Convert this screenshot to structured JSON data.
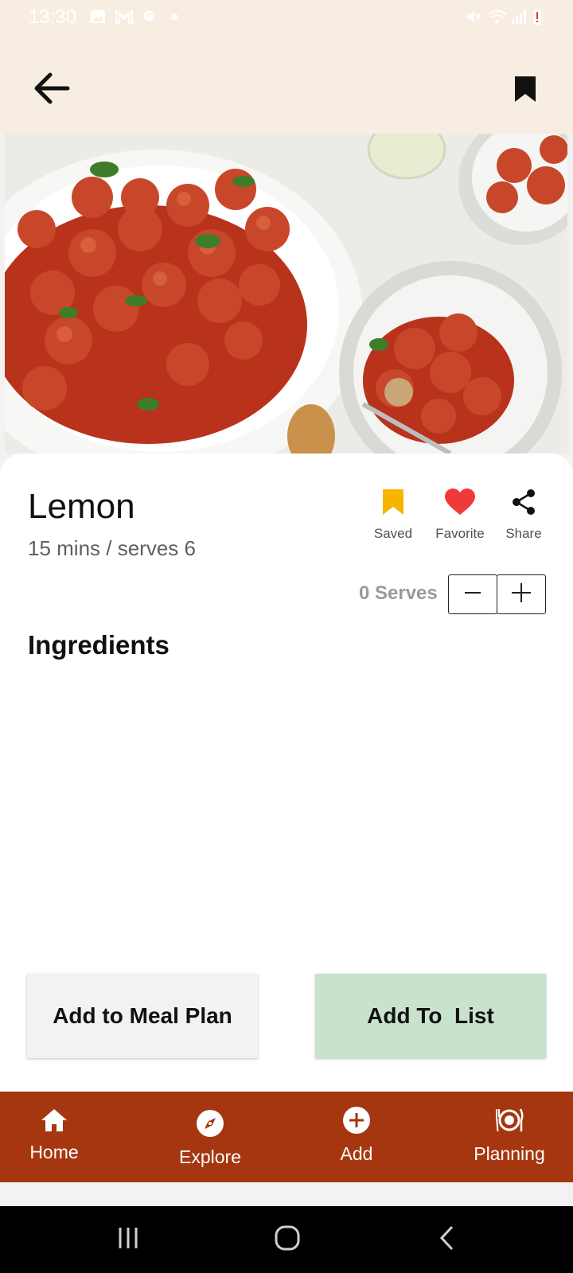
{
  "status_bar": {
    "time": "13:30",
    "left_icons": [
      "image-icon",
      "gmail-icon",
      "google-icon",
      "dot-icon"
    ],
    "right_icons": [
      "mute-icon",
      "wifi-icon",
      "signal-icon",
      "battery-alert-icon"
    ]
  },
  "app_bar": {
    "back_icon": "arrow-back-icon",
    "bookmark_icon": "bookmark-icon"
  },
  "recipe": {
    "title": "Lemon",
    "meta": "15 mins / serves 6",
    "image_subject": "meatballs in tomato sauce"
  },
  "actions": {
    "saved_label": "Saved",
    "favorite_label": "Favorite",
    "share_label": "Share",
    "saved_color": "#f7b500",
    "favorite_color": "#f03a3a"
  },
  "serves": {
    "label": "0 Serves"
  },
  "ingredients": {
    "heading": "Ingredients",
    "items": []
  },
  "buttons": {
    "meal_plan_label": "Add to Meal Plan",
    "list_label": "Add To  List"
  },
  "bottom_nav": {
    "items": [
      {
        "label": "Home",
        "icon": "home-icon"
      },
      {
        "label": "Explore",
        "icon": "compass-icon"
      },
      {
        "label": "Add",
        "icon": "add-circle-icon"
      },
      {
        "label": "Planning",
        "icon": "plate-icon"
      }
    ],
    "background": "#a6360f"
  },
  "system_nav": {
    "icons": [
      "recents-icon",
      "home-circle-icon",
      "back-chevron-icon"
    ]
  }
}
